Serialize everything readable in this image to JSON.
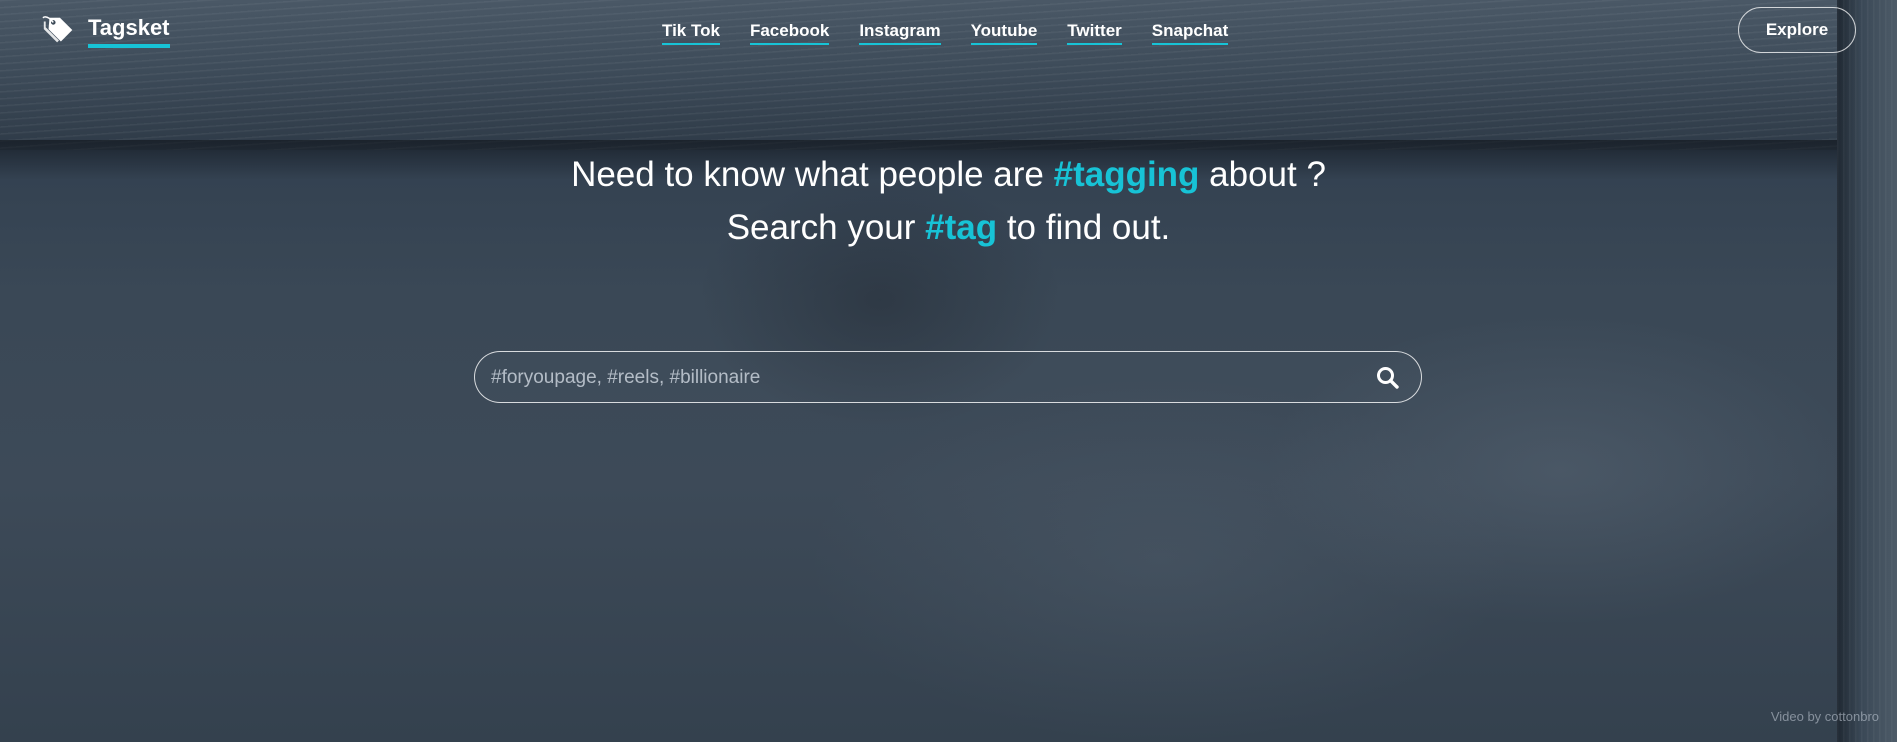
{
  "brand": {
    "name": "Tagsket",
    "icon": "tag-icon"
  },
  "nav": {
    "links": [
      {
        "label": "Tik Tok"
      },
      {
        "label": "Facebook"
      },
      {
        "label": "Instagram"
      },
      {
        "label": "Youtube"
      },
      {
        "label": "Twitter"
      },
      {
        "label": "Snapchat"
      }
    ],
    "explore_label": "Explore"
  },
  "hero": {
    "line1_before": "Need to know what people are ",
    "line1_tag": "#tagging",
    "line1_after": " about ?",
    "line2_before": "Search your ",
    "line2_tag": "#tag",
    "line2_after": " to find out."
  },
  "search": {
    "placeholder": "#foryoupage, #reels, #billionaire",
    "value": "",
    "icon": "search-icon"
  },
  "footer": {
    "credit": "Video by cottonbro"
  },
  "colors": {
    "accent": "#17c3d6",
    "text": "#ffffff",
    "background": "#37474f"
  }
}
